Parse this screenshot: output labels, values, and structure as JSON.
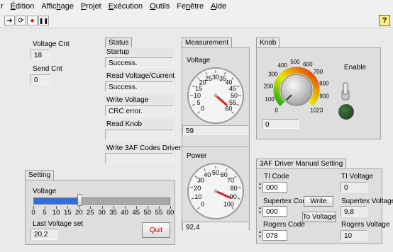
{
  "menu": {
    "items": [
      {
        "pre": "r ",
        "acc": "",
        "post": ""
      },
      {
        "pre": "",
        "acc": "É",
        "post": "dition"
      },
      {
        "pre": "Affic",
        "acc": "h",
        "post": "age"
      },
      {
        "pre": "",
        "acc": "P",
        "post": "rojet"
      },
      {
        "pre": "",
        "acc": "E",
        "post": "xécution"
      },
      {
        "pre": "",
        "acc": "O",
        "post": "utils"
      },
      {
        "pre": "Fe",
        "acc": "n",
        "post": "être"
      },
      {
        "pre": "",
        "acc": "A",
        "post": "ide"
      }
    ]
  },
  "toolbar": {
    "run_icon": "➔",
    "run_continuous_icon": "⟳",
    "abort_icon": "●",
    "pause_icon": "❚❚",
    "help_icon": "?"
  },
  "counters": {
    "voltage_cnt_label": "Voltage Cnt",
    "voltage_cnt_value": "18",
    "send_cnt_label": "Send Cnt",
    "send_cnt_value": "0"
  },
  "status": {
    "title": "Status",
    "startup_label": "Startup",
    "startup_value": "Success.",
    "read_vc_label": "Read Voltage/Current",
    "read_vc_value": "Success.",
    "write_voltage_label": "Write Voltage",
    "write_voltage_value": "CRC error.",
    "read_knob_label": "Read Knob",
    "read_knob_value": "",
    "write_3af_label": "Write 3AF Codes Drivers",
    "write_3af_value": ""
  },
  "measurement": {
    "title": "Measurement",
    "voltage_label": "Voltage",
    "voltage_value": "59",
    "voltage_gauge": {
      "ticks": [
        "0",
        "5",
        "10",
        "15",
        "20",
        "25",
        "30",
        "35",
        "40",
        "45",
        "50",
        "55",
        "60"
      ],
      "min": 0,
      "max": 60,
      "needle": 59
    },
    "power_label": "Power",
    "power_value": "92,4",
    "power_gauge": {
      "ticks": [
        "0",
        "10",
        "20",
        "30",
        "40",
        "50",
        "60",
        "70",
        "80",
        "90",
        "100"
      ],
      "min": 0,
      "max": 100,
      "needle": 92.4
    }
  },
  "knob": {
    "title": "Knob",
    "ticks": [
      "0",
      "100",
      "200",
      "300",
      "400",
      "500",
      "600",
      "700",
      "800",
      "900",
      "1023"
    ],
    "min": 0,
    "max": 1023,
    "value": "0",
    "enable_label": "Enable"
  },
  "setting": {
    "title": "Setting",
    "voltage_label": "Voltage",
    "slider_ticks": [
      "0",
      "5",
      "10",
      "15",
      "20",
      "25",
      "30",
      "35",
      "40",
      "45",
      "50",
      "55",
      "60"
    ],
    "slider_min": 0,
    "slider_max": 60,
    "slider_value": 20.2,
    "last_voltage_label": "Last Voltage set",
    "last_voltage_value": "20,2",
    "quit_label": "Quit"
  },
  "driver": {
    "title": "3AF Driver Manual Setting",
    "ti_code_label": "TI Code",
    "ti_code_value": "000",
    "supertex_code_label": "Supertex Code",
    "supertex_code_value": "000",
    "rogers_code_label": "Rogers Code",
    "rogers_code_value": "078",
    "write_label": "Write",
    "to_voltage_label": "To Voltage",
    "ti_voltage_label": "TI Voltage",
    "ti_voltage_value": "0",
    "supertex_voltage_label": "Supertex Voltage",
    "supertex_voltage_value": "9,8",
    "rogers_voltage_label": "Rogers Voltage",
    "rogers_voltage_value": "10"
  },
  "colors": {
    "slider_fill": "#2f6ee0",
    "needle": "#d42020",
    "knob_gradient": [
      "#1aa81a",
      "#e8e800",
      "#e88a00",
      "#d42020"
    ],
    "quit_text": "#c00000",
    "led_off": "#1e4a1e"
  }
}
